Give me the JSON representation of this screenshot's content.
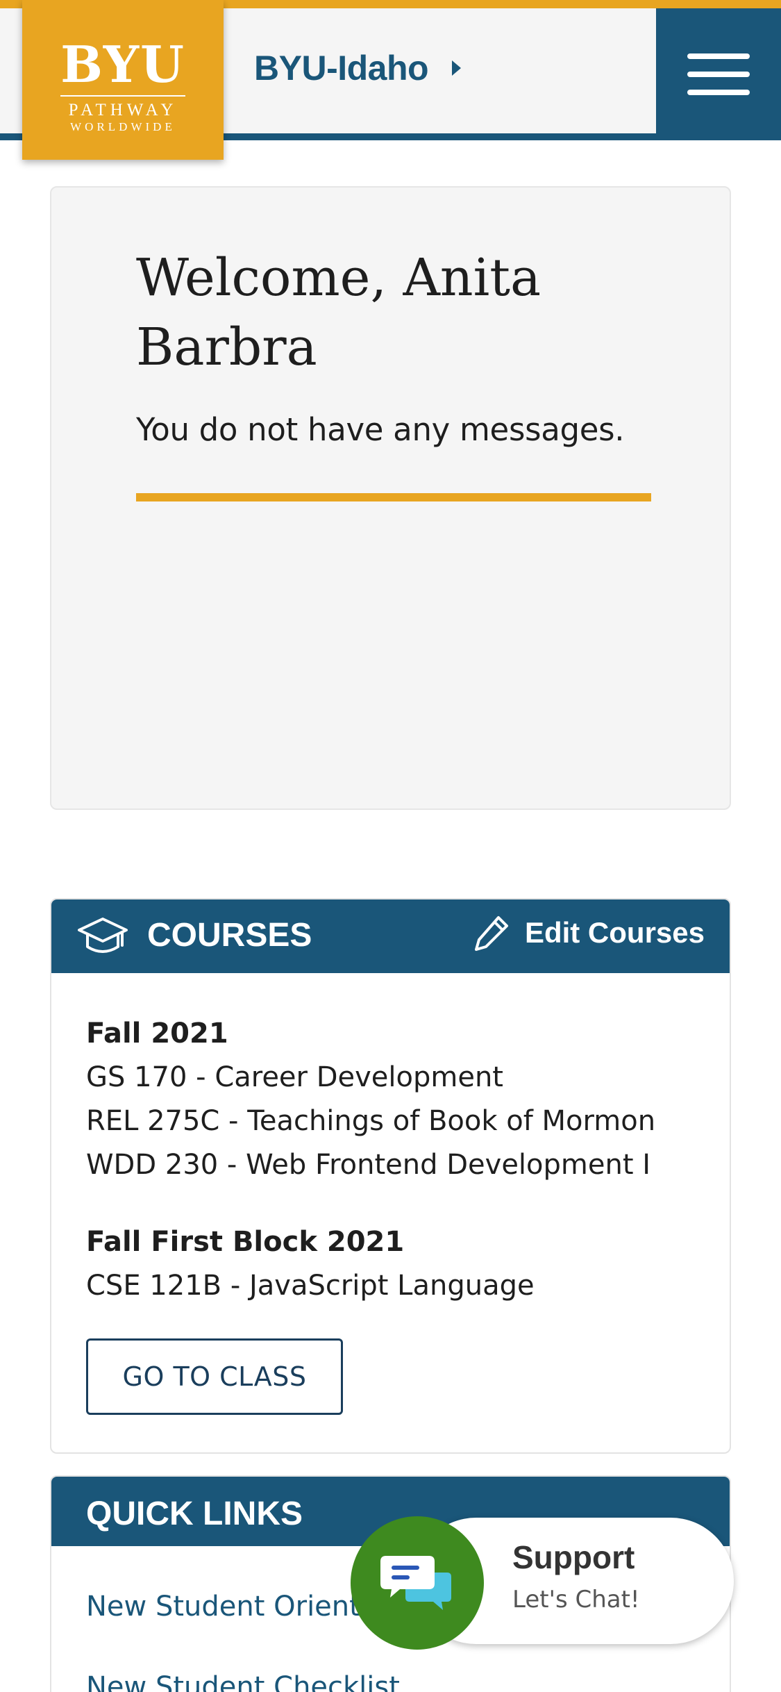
{
  "brand": {
    "logo_main": "BYU",
    "logo_sub1": "PATHWAY",
    "logo_sub2": "WORLDWIDE",
    "accent_color": "#e8a521",
    "primary_color": "#1a5679"
  },
  "header": {
    "breadcrumb": "BYU-Idaho",
    "menu_icon": "hamburger-menu-icon"
  },
  "welcome": {
    "title": "Welcome, Anita Barbra",
    "message": "You do not have any messages."
  },
  "courses": {
    "title": "COURSES",
    "icon": "graduation-cap-icon",
    "edit_label": "Edit Courses",
    "edit_icon": "pencil-icon",
    "terms": [
      {
        "name": "Fall 2021",
        "courses": [
          "GS 170 - Career Development",
          "REL 275C - Teachings of Book of Mormon",
          "WDD 230 - Web Frontend Development I"
        ]
      },
      {
        "name": "Fall First Block 2021",
        "courses": [
          "CSE 121B - JavaScript Language"
        ]
      }
    ],
    "go_button": "GO TO CLASS"
  },
  "quick_links": {
    "title": "QUICK LINKS",
    "items": [
      "New Student Orient",
      "New Student Checklist"
    ]
  },
  "support": {
    "title": "Support",
    "subtitle": "Let's Chat!",
    "icon": "chat-bubbles-icon",
    "color": "#3e8a1f"
  }
}
